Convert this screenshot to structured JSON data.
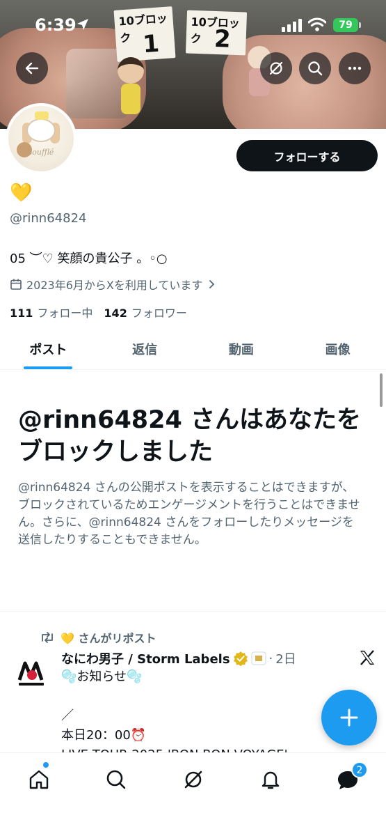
{
  "status_bar": {
    "time": "6:39",
    "battery": "79"
  },
  "header": {
    "back_icon": "arrow-left-icon",
    "grok_icon": "grok-icon",
    "search_icon": "search-icon",
    "more_icon": "more-horizontal-icon",
    "banner_signs": [
      {
        "top": "10ブロック",
        "number": "1"
      },
      {
        "top": "10ブロック",
        "number": "2"
      }
    ]
  },
  "avatar": {
    "brand": "soufflé"
  },
  "profile": {
    "follow_label": "フォローする",
    "display_name": "💛",
    "handle": "@rinn64824",
    "bio": "05 ︶♡ 笑顔の貴公子 。◦○",
    "joined": "2023年6月からXを利用しています",
    "following_count": "111",
    "following_label": "フォロー中",
    "followers_count": "142",
    "followers_label": "フォロワー"
  },
  "tabs": [
    {
      "label": "ポスト",
      "active": true
    },
    {
      "label": "返信",
      "active": false
    },
    {
      "label": "動画",
      "active": false
    },
    {
      "label": "画像",
      "active": false
    }
  ],
  "blocked": {
    "title": "@rinn64824 さんはあなたをブロックしました",
    "body": "@rinn64824 さんの公開ポストを表示することはできますが、ブロックされているためエンゲージメントを行うことはできません。さらに、@rinn64824 さんをフォローしたりメッセージを送信したりすることもできません。"
  },
  "post": {
    "repost_label": "💛 さんがリポスト",
    "author": "なにわ男子 / Storm Labels",
    "date": "2日",
    "text": "🫧お知らせ🫧\n\n／\n本日20：00⏰\nLIVE TOUR 2025 'BON BON VOYAGE'"
  },
  "bottom_nav": {
    "items": [
      "home-icon",
      "search-icon",
      "grok-icon",
      "notifications-icon",
      "messages-icon"
    ],
    "messages_badge": "2"
  },
  "colors": {
    "accent": "#1d9bf0",
    "text_primary": "#0f1419",
    "text_secondary": "#536471",
    "battery": "#34c759",
    "verified_gold": "#e2b719"
  }
}
